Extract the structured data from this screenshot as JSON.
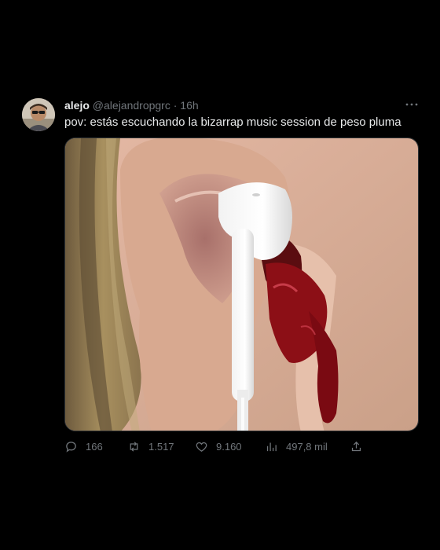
{
  "tweet": {
    "display_name": "alejo",
    "handle": "@alejandropgrc",
    "separator": "·",
    "time": "16h",
    "text": "pov: estás escuchando la bizarrap music session de peso pluma",
    "more_icon": "more-horizontal-icon",
    "media": {
      "description_icon": "photo-ear-earbud"
    }
  },
  "actions": {
    "replies": "166",
    "retweets": "1.517",
    "likes": "9.160",
    "views": "497,8 mil"
  },
  "icons": {
    "reply": "reply-icon",
    "retweet": "retweet-icon",
    "like": "heart-icon",
    "views": "views-icon",
    "share": "share-icon"
  },
  "colors": {
    "background": "#000000",
    "text_primary": "#e7e9ea",
    "text_secondary": "#71767b"
  }
}
